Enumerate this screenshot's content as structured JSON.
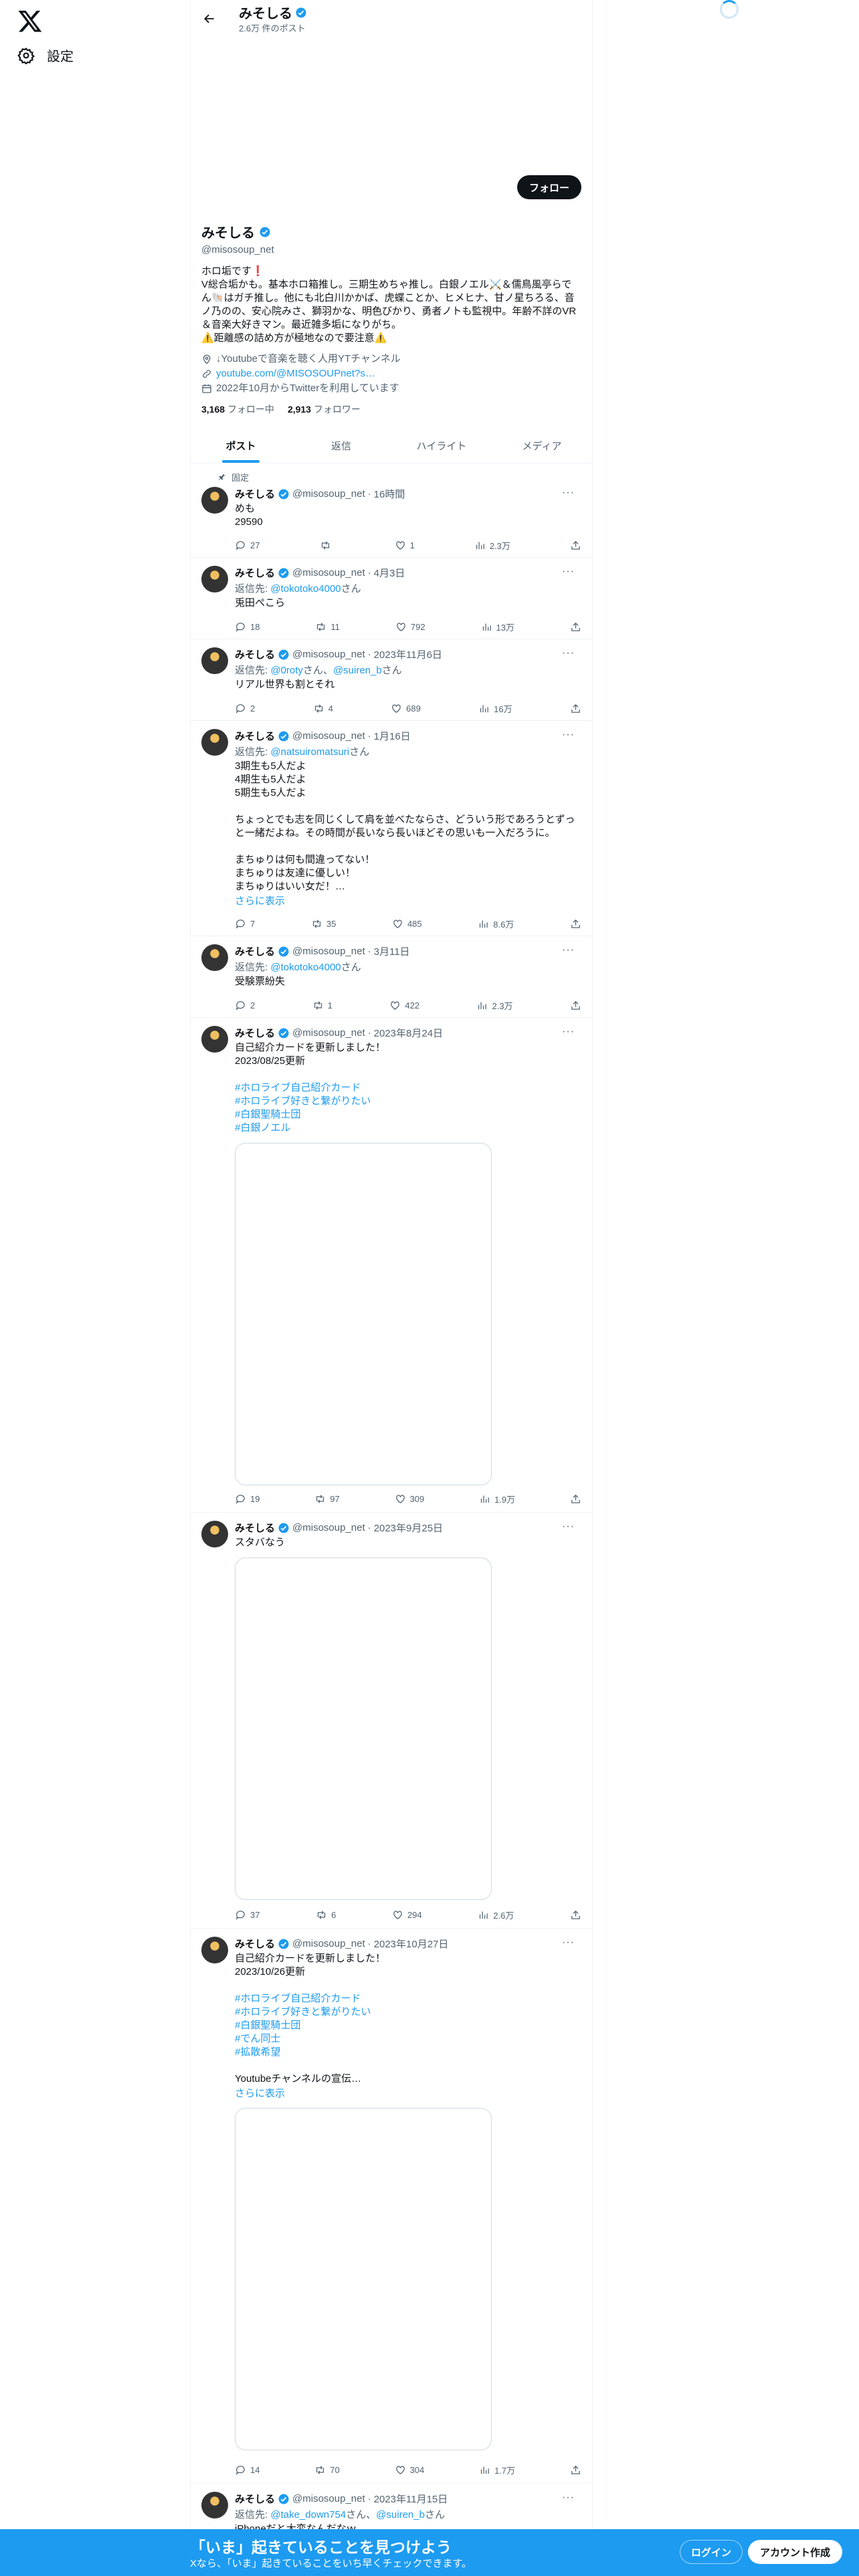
{
  "nav": {
    "settings_label": "設定"
  },
  "header": {
    "name": "みそしる",
    "post_count": "2.6万 件のポスト"
  },
  "profile": {
    "follow_label": "フォロー",
    "name": "みそしる",
    "handle": "@misosoup_net",
    "bio": "ホロ垢です❗\nV総合垢かも。基本ホロ箱推し。三期生めちゃ推し。白銀ノエル⚔️＆儒鳥風亭らでん🐚はガチ推し。他にも北白川かかば、虎蝶ことか、ヒメヒナ、甘ノ星ちろる、音ノ乃のの、安心院みさ、獅羽かな、明色びかり、勇者ノトも監視中。年齢不詳のVR＆音楽大好きマン。最近雑多垢になりがち。\n⚠️距離感の詰め方が極地なので要注意⚠️",
    "location": "↓Youtubeで音楽を聴く人用YTチャンネル",
    "website": "youtube.com/@MISOSOUPnet?s…",
    "joined": "2022年10月からTwitterを利用しています",
    "following_count": "3,168",
    "following_label": "フォロー中",
    "followers_count": "2,913",
    "followers_label": "フォロワー"
  },
  "tabs": [
    "ポスト",
    "返信",
    "ハイライト",
    "メディア"
  ],
  "pinned_label": "固定",
  "tweets": [
    {
      "name": "みそしる",
      "handle": "@misosoup_net",
      "time": "16時間",
      "reply_to": "",
      "text": "めも\n29590",
      "show_more": "",
      "replies": "27",
      "retweets": "",
      "likes": "1",
      "views": "2.3万"
    },
    {
      "name": "みそしる",
      "handle": "@misosoup_net",
      "time": "4月3日",
      "reply_prefix": "返信先: ",
      "reply_to": "@tokotoko4000",
      "reply_suffix": "さん",
      "text": "兎田ぺこら",
      "show_more": "",
      "replies": "18",
      "retweets": "11",
      "likes": "792",
      "views": "13万"
    },
    {
      "name": "みそしる",
      "handle": "@misosoup_net",
      "time": "2023年11月6日",
      "reply_prefix": "返信先: ",
      "reply_to": "@0roty",
      "reply_mid": "さん、",
      "reply_to2": "@suiren_b",
      "reply_suffix": "さん",
      "text": "リアル世界も割とそれ",
      "show_more": "",
      "replies": "2",
      "retweets": "4",
      "likes": "689",
      "views": "16万"
    },
    {
      "name": "みそしる",
      "handle": "@misosoup_net",
      "time": "1月16日",
      "reply_prefix": "返信先: ",
      "reply_to": "@natsuiromatsuri",
      "reply_suffix": "さん",
      "text": "3期生も5人だよ\n4期生も5人だよ\n5期生も5人だよ\n\nちょっとでも志を同じくして肩を並べたならさ、どういう形であろうとずっと一緒だよね。その時間が長いなら長いほどその思いも一入だろうに。\n\nまちゅりは何も間違ってない！\nまちゅりは友達に優しい！\nまちゅりはいい女だ！…",
      "show_more": "さらに表示",
      "replies": "7",
      "retweets": "35",
      "likes": "485",
      "views": "8.6万"
    },
    {
      "name": "みそしる",
      "handle": "@misosoup_net",
      "time": "3月11日",
      "reply_prefix": "返信先: ",
      "reply_to": "@tokotoko4000",
      "reply_suffix": "さん",
      "text": "受験票紛失",
      "show_more": "",
      "replies": "2",
      "retweets": "1",
      "likes": "422",
      "views": "2.3万"
    },
    {
      "name": "みそしる",
      "handle": "@misosoup_net",
      "time": "2023年8月24日",
      "text": "自己紹介カードを更新しました！\n2023/08/25更新",
      "tags": [
        "#ホロライブ自己紹介カード",
        "#ホロライブ好きと繋がりたい",
        "#白銀聖騎士団",
        "#白銀ノエル"
      ],
      "show_more": "",
      "replies": "19",
      "retweets": "97",
      "likes": "309",
      "views": "1.9万"
    },
    {
      "name": "みそしる",
      "handle": "@misosoup_net",
      "time": "2023年9月25日",
      "text": "スタバなう",
      "show_more": "",
      "replies": "37",
      "retweets": "6",
      "likes": "294",
      "views": "2.6万"
    },
    {
      "name": "みそしる",
      "handle": "@misosoup_net",
      "time": "2023年10月27日",
      "text": "自己紹介カードを更新しました！\n2023/10/26更新",
      "tags": [
        "#ホロライブ自己紹介カード",
        "#ホロライブ好きと繋がりたい",
        "#白銀聖騎士団",
        "#でん同士",
        "#拡散希望"
      ],
      "text2": "Youtubeチャンネルの宣伝…",
      "show_more": "さらに表示",
      "replies": "14",
      "retweets": "70",
      "likes": "304",
      "views": "1.7万"
    },
    {
      "name": "みそしる",
      "handle": "@misosoup_net",
      "time": "2023年11月15日",
      "reply_prefix": "返信先: ",
      "reply_to": "@take_down754",
      "reply_mid": "さん、",
      "reply_to2": "@suiren_b",
      "reply_suffix": "さん",
      "text": "iPhoneだと大変なんだなｗ",
      "show_more": ""
    }
  ],
  "banner": {
    "title": "「いま」起きていることを見つけよう",
    "subtitle": "Xなら、「いま」起きていることをいち早くチェックできます。",
    "login_label": "ログイン",
    "signup_label": "アカウント作成"
  },
  "colors": {
    "accent": "#1d9bf0",
    "text": "#0f1419",
    "muted": "#536471",
    "border": "#eff3f4"
  }
}
